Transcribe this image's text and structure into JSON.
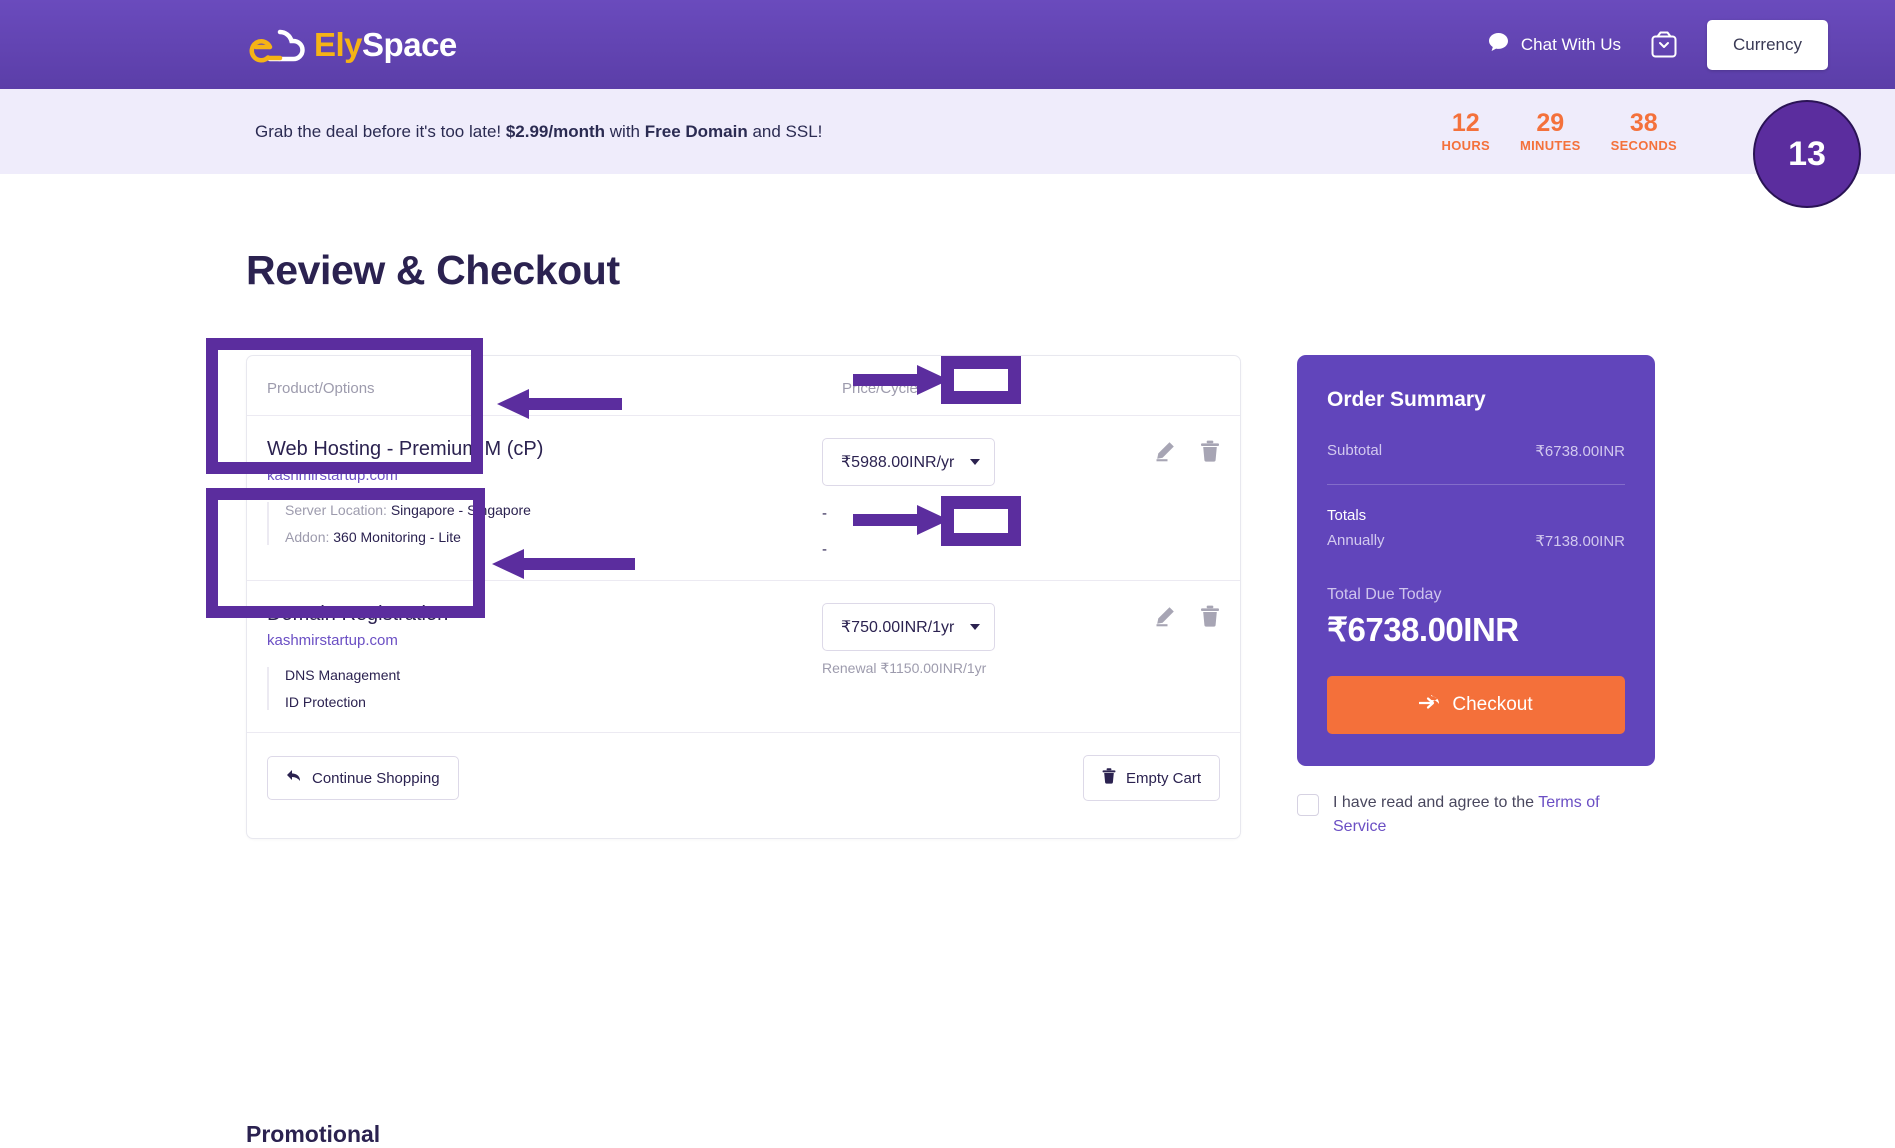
{
  "header": {
    "logo_ely": "Ely",
    "logo_space": "Space",
    "chat_label": "Chat With Us",
    "currency_label": "Currency",
    "cart_icon": "shopping-bag-icon",
    "chat_icon": "chat-bubble-icon"
  },
  "promo": {
    "text_plain_1": "Grab the deal before it's too late! ",
    "text_bold_1": "$2.99/month",
    "text_plain_2": " with ",
    "text_bold_2": "Free Domain",
    "text_plain_3": " and SSL!",
    "countdown": [
      {
        "value": "12",
        "label": "HOURS"
      },
      {
        "value": "29",
        "label": "MINUTES"
      },
      {
        "value": "38",
        "label": "SECONDS"
      }
    ],
    "badge_value": "13",
    "accent_color": "#f4713b"
  },
  "page": {
    "title": "Review & Checkout",
    "bottom_heading": "Promotional"
  },
  "cart": {
    "columns": {
      "product": "Product/Options",
      "price": "Price/Cycle"
    },
    "rows": [
      {
        "name": "Web Hosting - Premium M (cP)",
        "domain": "kashmirstartup.com",
        "options": [
          {
            "label": "Server Location:",
            "value": " Singapore - Singapore"
          },
          {
            "label": "Addon:",
            "value": " 360 Monitoring - Lite"
          }
        ],
        "price": "₹5988.00INR/yr",
        "option_price_1": "-",
        "option_price_2": "-",
        "edit_icon": "pencil-icon",
        "delete_icon": "trash-icon"
      },
      {
        "name": "Domain Registration",
        "domain": "kashmirstartup.com",
        "options": [
          {
            "label": "",
            "value": "DNS Management"
          },
          {
            "label": "",
            "value": "ID Protection"
          }
        ],
        "price": "₹750.00INR/1yr",
        "renewal": "Renewal ₹1150.00INR/1yr",
        "edit_icon": "pencil-icon",
        "delete_icon": "trash-icon"
      }
    ],
    "continue_label": "Continue Shopping",
    "empty_label": "Empty Cart"
  },
  "summary": {
    "title": "Order Summary",
    "subtotal_label": "Subtotal",
    "subtotal_value": "₹6738.00INR",
    "totals_label": "Totals",
    "annually_label": "Annually",
    "annually_value": "₹7138.00INR",
    "due_label": "Total Due Today",
    "due_value": "₹6738.00INR",
    "checkout_label": "Checkout",
    "checkout_color": "#f4703a",
    "panel_color": "#6145bb"
  },
  "terms": {
    "text_before": "I have read and agree to the ",
    "link": "Terms of Service",
    "checked": false
  }
}
